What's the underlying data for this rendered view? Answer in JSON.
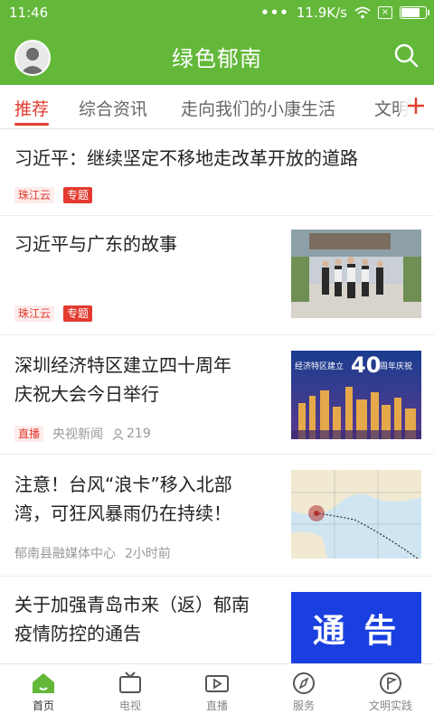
{
  "status_bar": {
    "time": "11:46",
    "network_speed": "11.9K/s",
    "signal_dots": "•••",
    "sim_label": "×",
    "battery_level": 0.85
  },
  "header": {
    "title": "绿色郁南"
  },
  "tabs": [
    {
      "label": "推荐",
      "active": true
    },
    {
      "label": "综合资讯",
      "active": false
    },
    {
      "label": "走向我们的小康生活",
      "active": false
    },
    {
      "label": "文明",
      "active": false
    }
  ],
  "articles": [
    {
      "title": "习近平：继续坚定不移地走改革开放的道路",
      "source": "珠江云",
      "tag": "专题"
    },
    {
      "title": "习近平与广东的故事",
      "source": "珠江云",
      "tag": "专题"
    },
    {
      "title_line1": "深圳经济特区建立四十周年",
      "title_line2": "庆祝大会今日举行",
      "badge": "直播",
      "source": "央视新闻",
      "views": "219",
      "thumb_caption": "经济特区建立",
      "thumb_number": "40",
      "thumb_suffix": "周年庆祝"
    },
    {
      "title_line1": "注意！台风“浪卡”移入北部",
      "title_line2": "湾，可狂风暴雨仍在持续！",
      "source": "郁南县融媒体中心",
      "time": "2小时前"
    },
    {
      "title_line1": "关于加强青岛市来（返）郁南",
      "title_line2": "疫情防控的通告",
      "thumb_text": "通 告"
    }
  ],
  "bottom_nav": [
    {
      "label": "首页",
      "icon": "home-icon",
      "active": true
    },
    {
      "label": "电视",
      "icon": "tv-icon",
      "active": false
    },
    {
      "label": "直播",
      "icon": "live-icon",
      "active": false
    },
    {
      "label": "服务",
      "icon": "compass-icon",
      "active": false
    },
    {
      "label": "文明实践",
      "icon": "flag-icon",
      "active": false
    }
  ],
  "colors": {
    "brand_green": "#63b83a",
    "accent_red": "#e33b2f"
  }
}
